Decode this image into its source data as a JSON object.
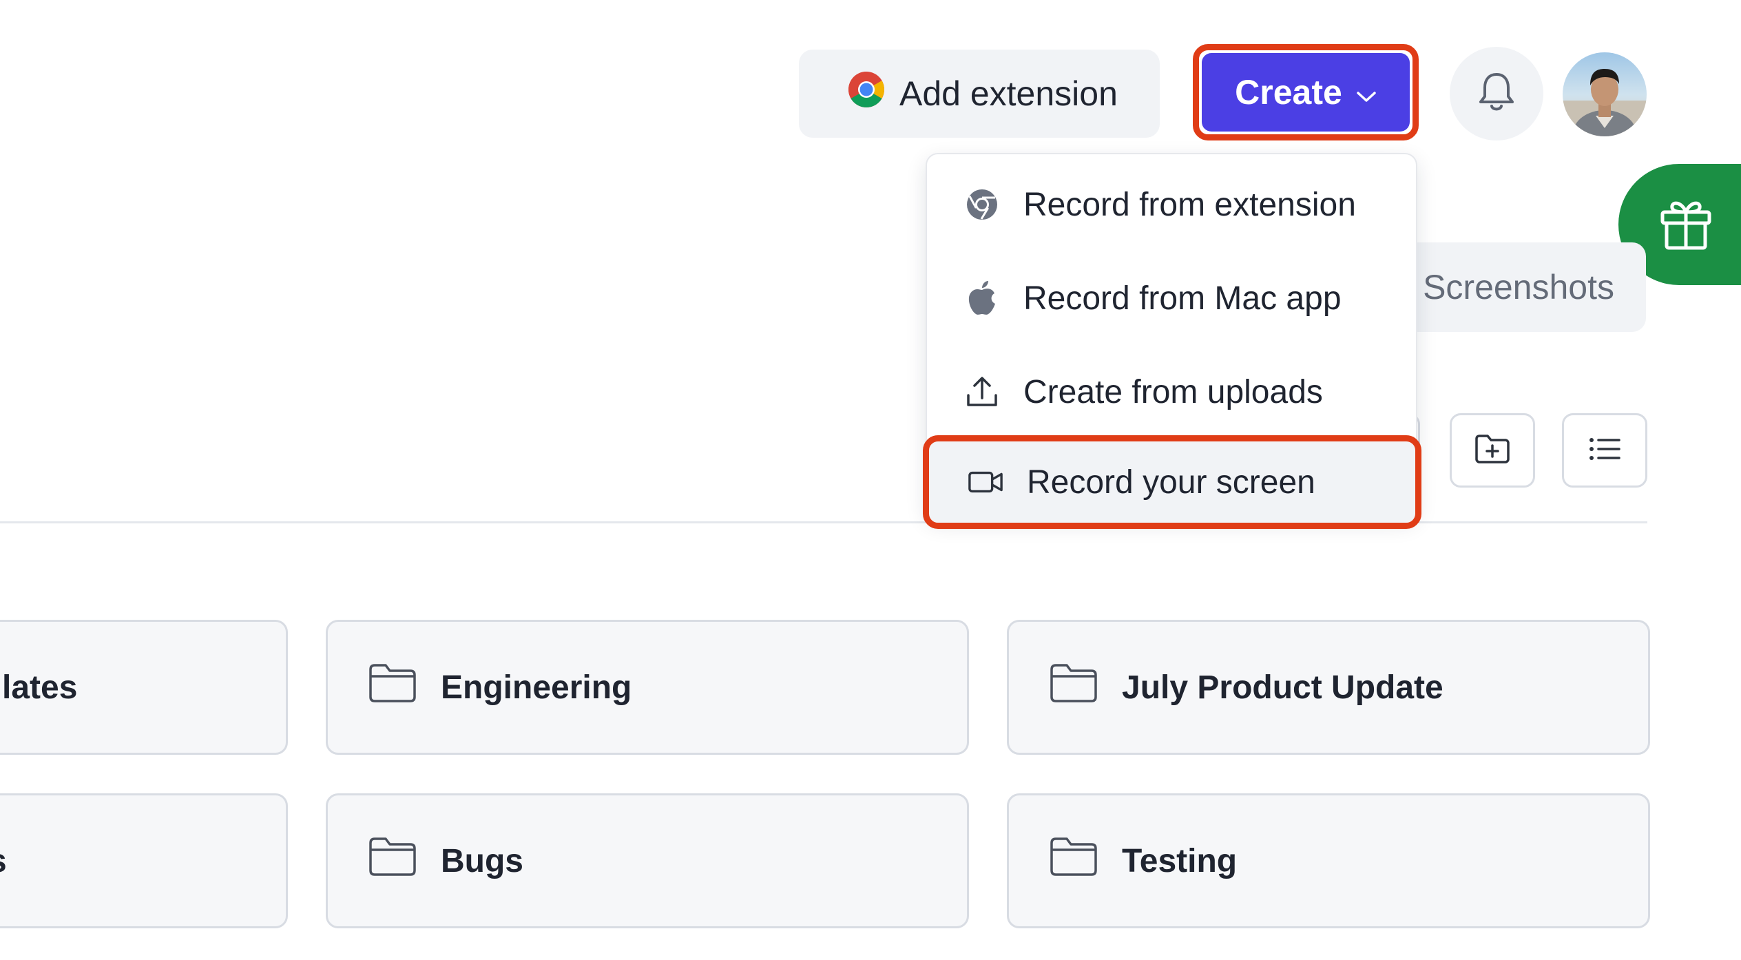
{
  "header": {
    "add_extension_label": "Add extension",
    "create_label": "Create",
    "icons": [
      "chrome-logo-icon",
      "chevron-down-icon",
      "bell-icon",
      "gift-icon"
    ]
  },
  "create_menu": {
    "items": [
      {
        "label": "Record from extension",
        "icon": "chrome-icon"
      },
      {
        "label": "Record from Mac app",
        "icon": "apple-icon"
      },
      {
        "label": "Create from uploads",
        "icon": "upload-icon"
      },
      {
        "label": "Record your screen",
        "icon": "video-camera-icon",
        "highlighted": true
      }
    ]
  },
  "tabs": {
    "screenshots_label": "Screenshots"
  },
  "toolbar": {
    "icons": [
      "new-folder-icon",
      "list-view-icon"
    ]
  },
  "folders": [
    {
      "label": "lates"
    },
    {
      "label": "Engineering"
    },
    {
      "label": "July Product Update"
    },
    {
      "label": "s"
    },
    {
      "label": "Bugs"
    },
    {
      "label": "Testing"
    }
  ],
  "colors": {
    "primary": "#4b3fe4",
    "highlight_outline": "#e03c16",
    "gift_green": "#1b8f44",
    "card_bg": "#f6f7f9",
    "muted_text": "#646b78"
  }
}
